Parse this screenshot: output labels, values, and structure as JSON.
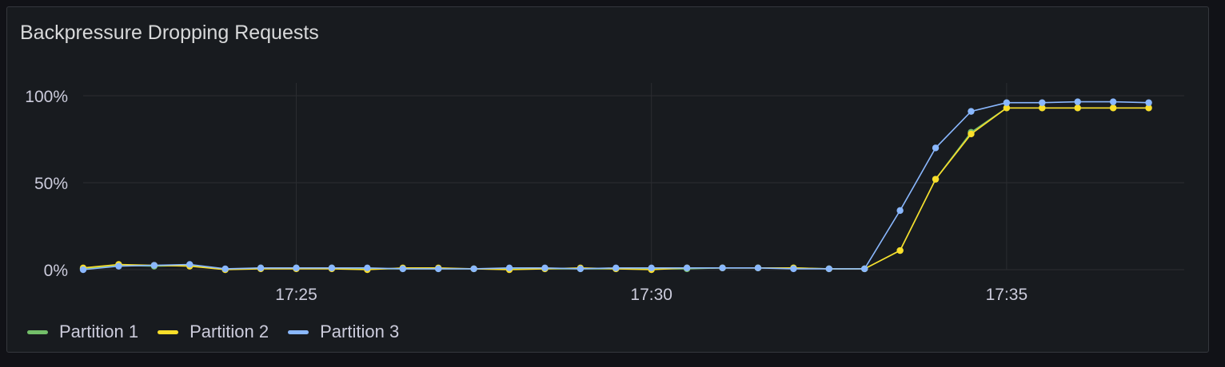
{
  "panel": {
    "title": "Backpressure Dropping Requests"
  },
  "colors": {
    "background": "#181b1f",
    "grid": "#2b2d31",
    "axis_text": "#ccccdc",
    "series": [
      "#73bf69",
      "#fade2a",
      "#8ab8ff"
    ]
  },
  "chart_data": {
    "type": "line",
    "title": "Backpressure Dropping Requests",
    "xlabel": "",
    "ylabel": "",
    "ylim": [
      0,
      100
    ],
    "y_ticks": [
      {
        "value": 0,
        "label": "0%"
      },
      {
        "value": 50,
        "label": "50%"
      },
      {
        "value": 100,
        "label": "100%"
      }
    ],
    "xlim": [
      "17:22:00",
      "17:37:30"
    ],
    "x_ticks": [
      {
        "value": "17:25:00",
        "label": "17:25"
      },
      {
        "value": "17:30:00",
        "label": "17:30"
      },
      {
        "value": "17:35:00",
        "label": "17:35"
      }
    ],
    "grid": true,
    "legend_position": "bottom-left",
    "x": [
      "17:22:00",
      "17:22:30",
      "17:23:00",
      "17:23:30",
      "17:24:00",
      "17:24:30",
      "17:25:00",
      "17:25:30",
      "17:26:00",
      "17:26:30",
      "17:27:00",
      "17:27:30",
      "17:28:00",
      "17:28:30",
      "17:29:00",
      "17:29:30",
      "17:30:00",
      "17:30:30",
      "17:31:00",
      "17:31:30",
      "17:32:00",
      "17:32:30",
      "17:33:00",
      "17:33:30",
      "17:34:00",
      "17:34:30",
      "17:35:00",
      "17:35:30",
      "17:36:00",
      "17:36:30",
      "17:37:00"
    ],
    "series": [
      {
        "name": "Partition 1",
        "color": "#73bf69",
        "values": [
          0.5,
          2.5,
          2,
          2.5,
          0,
          1,
          1,
          1,
          0.5,
          0.5,
          0.5,
          0.5,
          0.5,
          0.5,
          0.5,
          0.5,
          0.5,
          0.5,
          1,
          1,
          1,
          0.5,
          0.5,
          11,
          52,
          79,
          93,
          93,
          93,
          93,
          93
        ]
      },
      {
        "name": "Partition 2",
        "color": "#fade2a",
        "values": [
          1,
          3,
          2.5,
          2,
          0,
          0.5,
          0.5,
          0.5,
          0,
          1,
          1,
          0.5,
          0,
          0.5,
          1,
          0.5,
          0,
          1,
          1,
          1,
          1,
          0.5,
          0.5,
          11,
          52,
          78,
          93,
          93,
          93,
          93,
          93
        ]
      },
      {
        "name": "Partition 3",
        "color": "#8ab8ff",
        "values": [
          0,
          2,
          2.5,
          3,
          0.5,
          1,
          1,
          1,
          1,
          0.5,
          0.5,
          0.5,
          1,
          1,
          0.5,
          1,
          1,
          1,
          1,
          1,
          0.5,
          0.5,
          0.5,
          34,
          70,
          91,
          96,
          96,
          96.5,
          96.5,
          96
        ]
      }
    ]
  }
}
